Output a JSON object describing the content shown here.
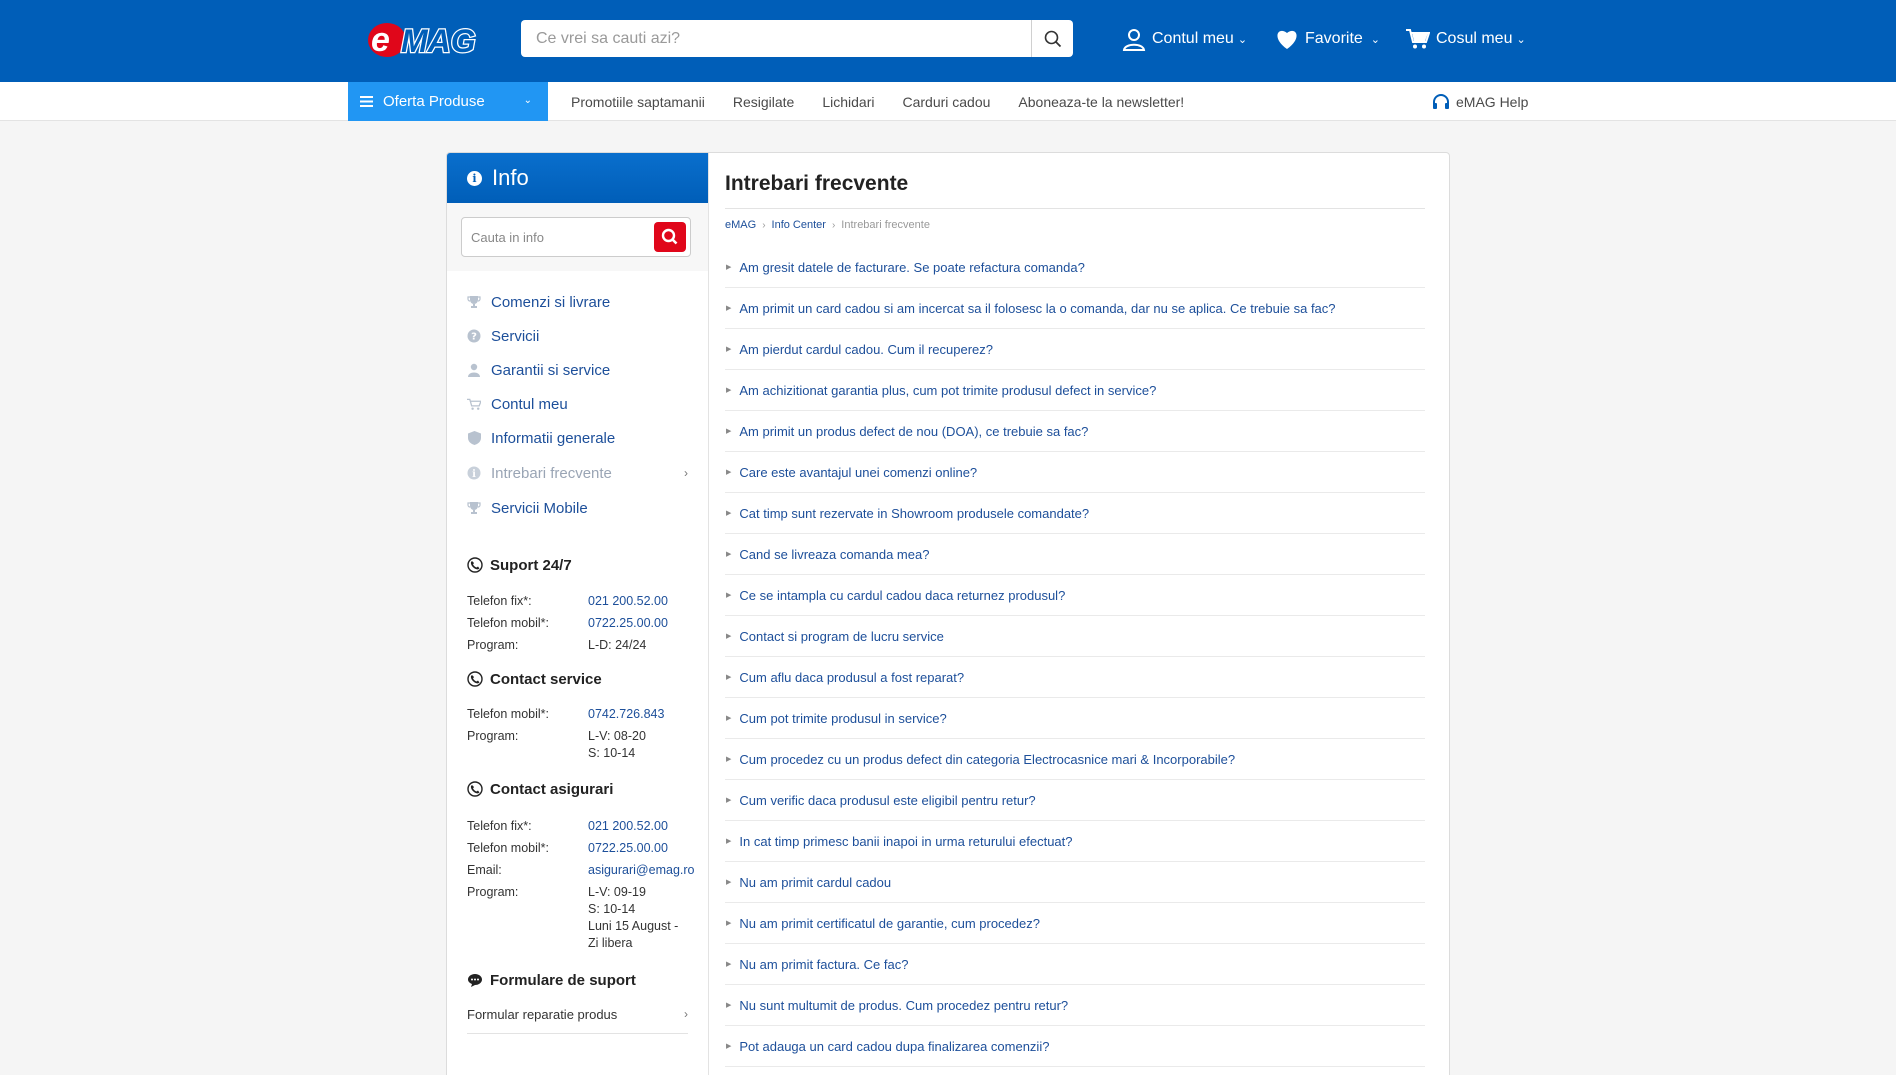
{
  "header": {
    "logo_text": "eMAG",
    "search_placeholder": "Ce vrei sa cauti azi?",
    "account_label": "Contul meu",
    "favorites_label": "Favorite",
    "cart_label": "Cosul meu",
    "brand_color": "#005eb8"
  },
  "nav": {
    "products_label": "Oferta Produse",
    "links": [
      "Promotiile saptamanii",
      "Resigilate",
      "Lichidari",
      "Carduri cadou",
      "Aboneaza-te la newsletter!"
    ],
    "help_label": "eMAG Help"
  },
  "sidebar": {
    "title": "Info",
    "search_placeholder": "Cauta in info",
    "menu": [
      {
        "label": "Comenzi si livrare",
        "icon": "trophy-icon"
      },
      {
        "label": "Servicii",
        "icon": "question-icon"
      },
      {
        "label": "Garantii si service",
        "icon": "person-icon"
      },
      {
        "label": "Contul meu",
        "icon": "cart-icon"
      },
      {
        "label": "Informatii generale",
        "icon": "shield-icon"
      },
      {
        "label": "Intrebari frecvente",
        "icon": "info-icon",
        "active": true
      },
      {
        "label": "Servicii Mobile",
        "icon": "trophy-icon"
      }
    ],
    "support": {
      "title": "Suport 24/7",
      "rows": [
        {
          "k": "Telefon fix*:",
          "v": "021 200.52.00"
        },
        {
          "k": "Telefon mobil*:",
          "v": "0722.25.00.00"
        },
        {
          "k": "Program:",
          "v": "L-D: 24/24"
        }
      ]
    },
    "service": {
      "title": "Contact service",
      "rows": [
        {
          "k": "Telefon mobil*:",
          "v": "0742.726.843"
        },
        {
          "k": "Program:",
          "v": "L-V: 08-20\nS: 10-14"
        }
      ]
    },
    "insurance": {
      "title": "Contact asigurari",
      "rows": [
        {
          "k": "Telefon fix*:",
          "v": "021 200.52.00"
        },
        {
          "k": "Telefon mobil*:",
          "v": "0722.25.00.00"
        },
        {
          "k": "Email:",
          "v": "asigurari@emag.ro"
        },
        {
          "k": "Program:",
          "v": "L-V: 09-19\nS: 10-14\nLuni 15 August -\nZi libera"
        }
      ]
    },
    "forms": {
      "title": "Formulare de suport",
      "item": "Formular reparatie produs"
    }
  },
  "content": {
    "title": "Intrebari frecvente",
    "breadcrumb": [
      "eMAG",
      "Info Center",
      "Intrebari frecvente"
    ],
    "faqs": [
      "Am gresit datele de facturare. Se poate refactura comanda?",
      "Am primit un card cadou si am incercat sa il folosesc la o comanda, dar nu se aplica. Ce trebuie sa fac?",
      "Am pierdut cardul cadou. Cum il recuperez?",
      "Am achizitionat garantia plus, cum pot trimite produsul defect in service?",
      "Am primit un produs defect de nou (DOA), ce trebuie sa fac?",
      "Care este avantajul unei comenzi online?",
      "Cat timp sunt rezervate in Showroom produsele comandate?",
      "Cand se livreaza comanda mea?",
      "Ce se intampla cu cardul cadou daca returnez produsul?",
      "Contact si program de lucru service",
      "Cum aflu daca produsul a fost reparat?",
      "Cum pot trimite produsul in service?",
      "Cum procedez cu un produs defect din categoria Electrocasnice mari & Incorporabile?",
      "Cum verific daca produsul este eligibil pentru retur?",
      "In cat timp primesc banii inapoi in urma returului efectuat?",
      "Nu am primit cardul cadou",
      "Nu am primit certificatul de garantie, cum procedez?",
      "Nu am primit factura. Ce fac?",
      "Nu sunt multumit de produs. Cum procedez pentru retur?",
      "Pot adauga un card cadou dupa finalizarea comenzii?"
    ]
  }
}
